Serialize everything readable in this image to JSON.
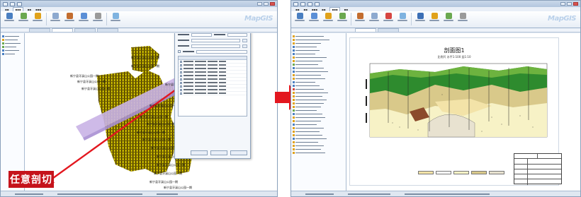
{
  "caption": "任意剖切",
  "left_window": {
    "title": "",
    "logo": "MapGIS",
    "borehole_label": "新宁县牙溪山公园一期",
    "panel": {
      "rows": 14
    }
  },
  "right_window": {
    "title": "",
    "logo": "MapGIS",
    "section_title": "剖面图1",
    "section_subtitle": "比例尺 水平1:100 竖1:10",
    "layer_colors": [
      "#2e8b2e",
      "#6db33f",
      "#f3e3a8",
      "#d9c98a",
      "#f7f2c6",
      "#8b4a2b",
      "#e8e2d0"
    ]
  },
  "colors": {
    "accent": "#c5131b",
    "cut_plane": "#c9b3e6",
    "borehole": "#c4b400",
    "borehole_dark": "#3a2a00"
  }
}
